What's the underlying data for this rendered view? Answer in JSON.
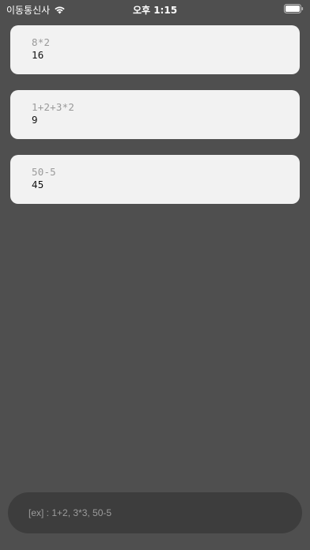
{
  "status_bar": {
    "carrier": "이동통신사",
    "time": "오후 1:15",
    "wifi_icon": "wifi-icon",
    "battery_icon": "battery-icon"
  },
  "results": [
    {
      "expression": "8*2",
      "value": "16"
    },
    {
      "expression": "1+2+3*2",
      "value": "9"
    },
    {
      "expression": "50-5",
      "value": "45"
    }
  ],
  "input": {
    "value": "",
    "placeholder": "[ex] : 1+2, 3*3, 50-5"
  },
  "colors": {
    "background": "#4f4f4f",
    "card": "#f2f2f2",
    "input_bg": "#3d3d3d"
  }
}
